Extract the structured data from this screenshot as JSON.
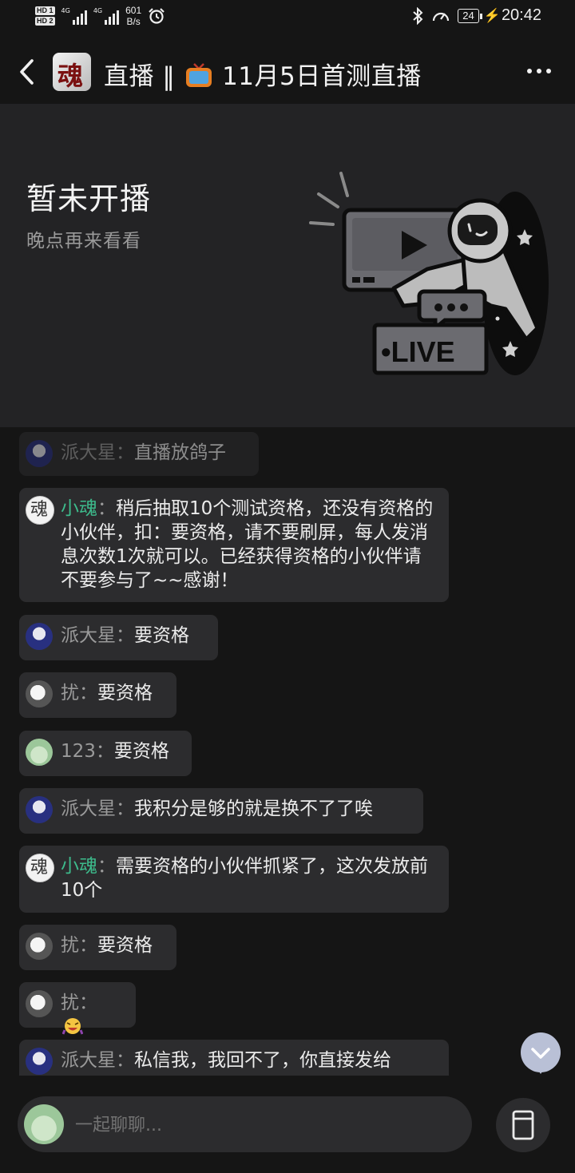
{
  "status_bar": {
    "hd1": "HD 1",
    "hd2": "HD 2",
    "net1": "4G",
    "net2": "4G",
    "speed_value": "601",
    "speed_unit": "B/s",
    "battery": "24",
    "time": "20:42"
  },
  "header": {
    "title_prefix": "直播 ‖ ",
    "title_suffix": "11月5日首测直播",
    "channel_avatar_glyph": "魂"
  },
  "live_banner": {
    "title": "暂未开播",
    "subtitle": "晚点再来看看",
    "badge_text": "•LIVE"
  },
  "messages": [
    {
      "name": "派大星",
      "sep": "：",
      "text": "直播放鸽子"
    },
    {
      "name": "小魂",
      "sep": "：",
      "text": "稍后抽取10个测试资格，还没有资格的小伙伴，扣：要资格，请不要刷屏，每人发消息次数1次就可以。已经获得资格的小伙伴请不要参与了~~感谢！"
    },
    {
      "name": "派大星",
      "sep": "：",
      "text": "要资格"
    },
    {
      "name": "扰",
      "sep": "：",
      "text": "要资格"
    },
    {
      "name": "123",
      "sep": "：",
      "text": "要资格"
    },
    {
      "name": "派大星",
      "sep": "：",
      "text": "我积分是够的就是换不了了唉"
    },
    {
      "name": "小魂",
      "sep": "：",
      "text": "需要资格的小伙伴抓紧了，这次发放前10个"
    },
    {
      "name": "扰",
      "sep": "：",
      "text": "要资格"
    },
    {
      "name": "扰",
      "sep": "：",
      "text": ""
    },
    {
      "name": "派大星",
      "sep": "：",
      "text": "私信我，我回不了，你直接发给"
    }
  ],
  "input": {
    "placeholder": "一起聊聊..."
  },
  "colors": {
    "background": "#151515",
    "banner": "#232325",
    "bubble": "#2c2c2e",
    "admin_name": "#3dbb8c",
    "user_name": "#9a9a9a"
  }
}
